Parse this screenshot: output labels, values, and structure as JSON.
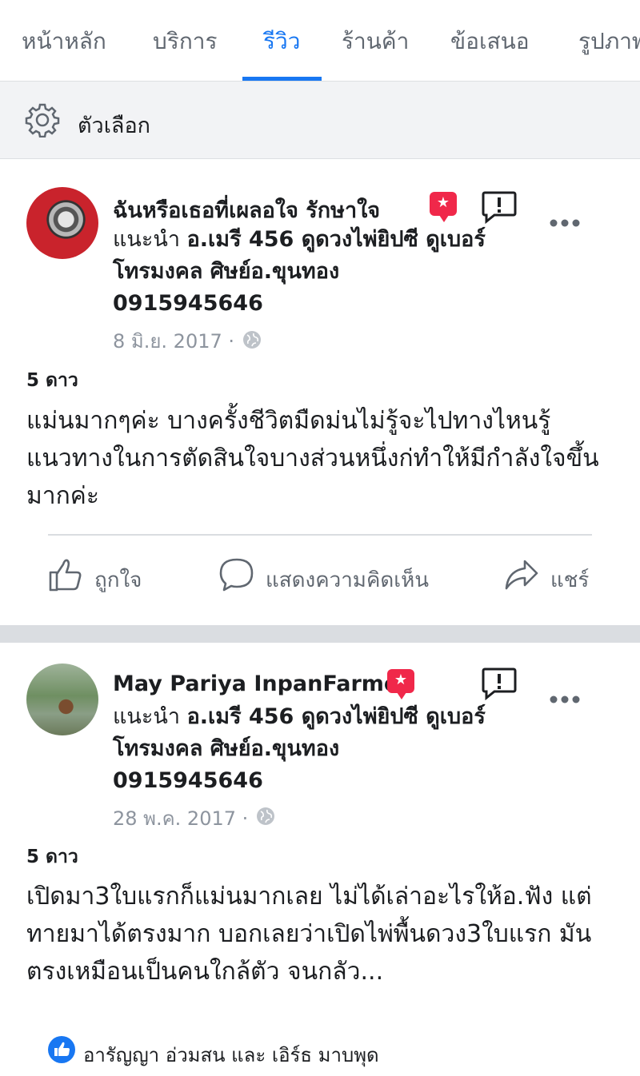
{
  "tabs": [
    {
      "label": "หน้าหลัก"
    },
    {
      "label": "บริการ"
    },
    {
      "label": "รีวิว"
    },
    {
      "label": "ร้านค้า"
    },
    {
      "label": "ข้อเสนอ"
    },
    {
      "label": "รูปภาพ"
    }
  ],
  "active_tab": "รีวิว",
  "options_label": "ตัวเลือก",
  "accent_color": "#1877f2",
  "badge_color": "#f0284a",
  "reviews": [
    {
      "author": "ฉันหรือเธอที่เผลอใจ รักษาใจ",
      "rec_prefix": "แนะนำ",
      "rec_target": "อ.เมรี 456 ดูดวงไพ่ยิปซี ดูเบอร์โทรมงคล ศิษย์อ.ขุนทอง 0915945646",
      "date": "8 มิ.ย. 2017 ·",
      "rating": "5 ดาว",
      "text": "แม่นมากๆค่ะ  บางครั้งชีวิตมืดม่นไม่รู้จะไปทางไหนรู้แนวทางในการตัดสินใจบางส่วนหนึ่งก่ทำให้มีกำลังใจขึ้นมากค่ะ",
      "actions": {
        "like": "ถูกใจ",
        "comment": "แสดงความคิดเห็น",
        "share": "แชร์"
      }
    },
    {
      "author": "May Pariya InpanFarmer",
      "rec_prefix": "แนะนำ",
      "rec_target": "อ.เมรี 456 ดูดวงไพ่ยิปซี ดูเบอร์โทรมงคล ศิษย์อ.ขุนทอง 0915945646",
      "date": "28 พ.ค. 2017 ·",
      "rating": "5 ดาว",
      "text": "เปิดมา3ใบแรกก็แม่นมากเลย ไม่ได้เล่าอะไรให้อ.ฟัง แต่ทายมาได้ตรงมาก บอกเลยว่าเปิดไพ่พื้นดวง3ใบแรก มันตรงเหมือนเป็นคนใกล้ตัว จนกลัว...",
      "likes": "อารัญญา อ่วมสน และ เอิร์ธ มาบพุด"
    }
  ]
}
